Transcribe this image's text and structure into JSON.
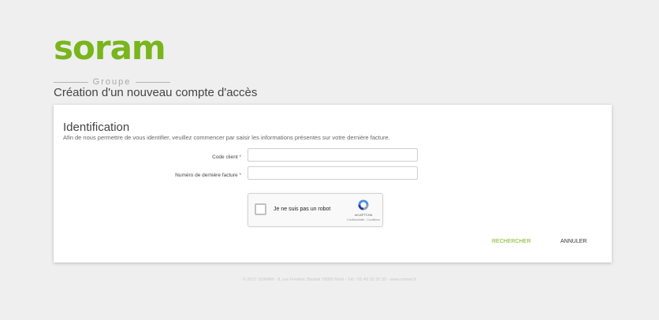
{
  "brand": {
    "name": "soram",
    "subtitle": "Groupe",
    "color": "#79b51c"
  },
  "page": {
    "title": "Création d'un nouveau compte d'accès"
  },
  "identification": {
    "title": "Identification",
    "description": "Afin de nous permettre de vous identifier, veuillez commencer par saisir les informations présentes sur votre dernière facture.",
    "fields": [
      {
        "label": "Code client",
        "required_mark": "*",
        "value": ""
      },
      {
        "label": "Numéro de dernière facture",
        "required_mark": "*",
        "value": ""
      }
    ],
    "recaptcha": {
      "label": "Je ne suis pas un robot",
      "brand": "reCAPTCHA",
      "terms": "Confidentialité - Conditions",
      "checked": false
    }
  },
  "actions": {
    "search_label": "RECHERCHER",
    "cancel_label": "ANNULER"
  },
  "footer": {
    "text": "© 2017 SORAM - 8, rue Frédéric Bastiat 79000 Niort - Tél : 05 49 33 33 33 - www.soram.fr"
  }
}
